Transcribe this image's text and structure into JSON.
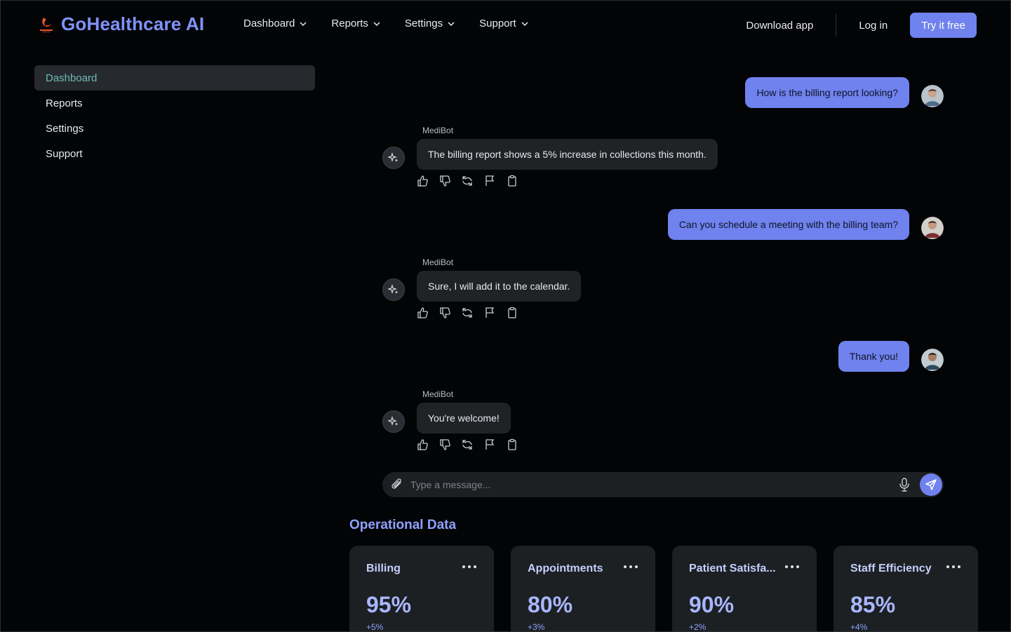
{
  "brand": {
    "name": "GoHealthcare AI"
  },
  "nav": {
    "items": [
      {
        "label": "Dashboard"
      },
      {
        "label": "Reports"
      },
      {
        "label": "Settings"
      },
      {
        "label": "Support"
      }
    ],
    "download": "Download app",
    "login": "Log in",
    "try": "Try it free"
  },
  "sidebar": {
    "items": [
      {
        "label": "Dashboard",
        "active": true
      },
      {
        "label": "Reports"
      },
      {
        "label": "Settings"
      },
      {
        "label": "Support"
      }
    ]
  },
  "chat": {
    "bot_name": "MediBot",
    "messages": [
      {
        "role": "user",
        "text": "How is the billing report looking?"
      },
      {
        "role": "bot",
        "text": "The billing report shows a 5% increase in collections this month."
      },
      {
        "role": "user",
        "text": "Can you schedule a meeting with the billing team?"
      },
      {
        "role": "bot",
        "text": "Sure, I will add it to the calendar."
      },
      {
        "role": "user",
        "text": "Thank you!"
      },
      {
        "role": "bot",
        "text": "You're welcome!"
      }
    ],
    "input": {
      "placeholder": "Type a message...",
      "value": ""
    }
  },
  "operational": {
    "title": "Operational Data",
    "cards": [
      {
        "title": "Billing",
        "value": "95%",
        "delta": "+5%"
      },
      {
        "title": "Appointments",
        "value": "80%",
        "delta": "+3%"
      },
      {
        "title": "Patient Satisfa...",
        "value": "90%",
        "delta": "+2%"
      },
      {
        "title": "Staff Efficiency",
        "value": "85%",
        "delta": "+4%"
      }
    ]
  },
  "colors": {
    "accent": "#6f82ee",
    "brand": "#7f93ff",
    "sidebar_active_text": "#6fb9b4",
    "bubble_bot": "#1f2326",
    "card_bg": "#1c2022"
  }
}
